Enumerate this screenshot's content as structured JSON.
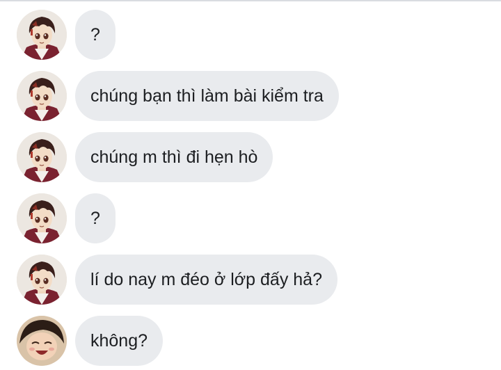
{
  "thread": {
    "messages": [
      {
        "sender": "tanjiro",
        "text": "?"
      },
      {
        "sender": "tanjiro",
        "text": "chúng bạn thì làm bài kiểm tra"
      },
      {
        "sender": "tanjiro",
        "text": "chúng m thì đi hẹn hò"
      },
      {
        "sender": "tanjiro",
        "text": "?"
      },
      {
        "sender": "tanjiro",
        "text": "lí do nay m đéo ở lớp đấy hả?"
      },
      {
        "sender": "other",
        "text": "không?"
      }
    ]
  },
  "colors": {
    "bubble_bg": "#e9ebee",
    "text": "#1c1e21",
    "divider": "#d9dce1",
    "avatar_hair": "#3a1f1b",
    "avatar_haori": "#7a2230",
    "avatar_skin": "#f3dcc6"
  },
  "icons": {
    "sender_avatar": "anime-boy-avatar",
    "other_avatar": "laughing-girl-avatar"
  }
}
